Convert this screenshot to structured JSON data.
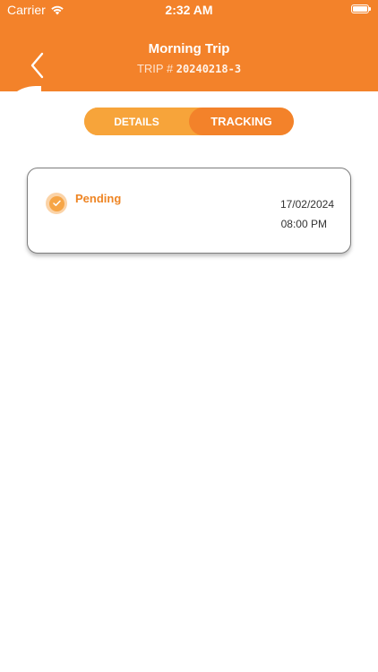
{
  "status_bar": {
    "carrier": "Carrier",
    "time": "2:32 AM"
  },
  "header": {
    "title": "Morning Trip",
    "subtitle_prefix": "TRIP #",
    "trip_number": "20240218-3",
    "background_color": "#f3822a"
  },
  "tabs": {
    "details_label": "DETAILS",
    "tracking_label": "TRACKING",
    "active": "tracking"
  },
  "tracking_entries": [
    {
      "status": "Pending",
      "date": "17/02/2024",
      "time": "08:00 PM",
      "icon": "check-circle-icon",
      "status_color": "#ee8524"
    }
  ]
}
